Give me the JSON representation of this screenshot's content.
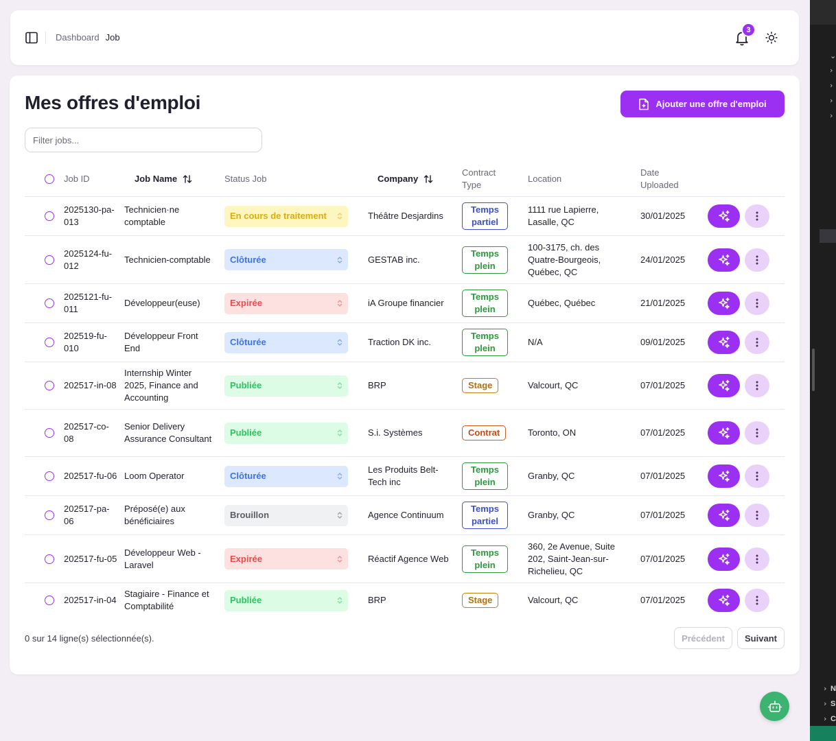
{
  "header": {
    "breadcrumb": [
      "Dashboard",
      "Job"
    ],
    "notification_count": "3"
  },
  "page": {
    "title": "Mes offres d'emploi",
    "add_button_label": "Ajouter une offre d'emploi",
    "filter_placeholder": "Filter jobs..."
  },
  "table": {
    "columns": {
      "job_id": "Job ID",
      "job_name": "Job Name",
      "status": "Status Job",
      "company": "Company",
      "contract": "Contract Type",
      "location": "Location",
      "date": "Date Uploaded"
    },
    "rows": [
      {
        "id": "2025130-pa-013",
        "name": "Technicien·ne comptable",
        "status": "En cours de traitement",
        "status_kind": "processing",
        "company": "Théâtre Desjardins",
        "contract": "Temps partiel",
        "contract_kind": "partial",
        "location": "1111 rue Lapierre, Lasalle, QC",
        "date": "30/01/2025"
      },
      {
        "id": "2025124-fu-012",
        "name": "Technicien-comptable",
        "status": "Clôturée",
        "status_kind": "closed",
        "company": "GESTAB inc.",
        "contract": "Temps plein",
        "contract_kind": "full",
        "location": "100-3175, ch. des Quatre-Bourgeois, Québec, QC",
        "date": "24/01/2025"
      },
      {
        "id": "2025121-fu-011",
        "name": "Développeur(euse)",
        "status": "Expirée",
        "status_kind": "expired",
        "company": "iA Groupe financier",
        "contract": "Temps plein",
        "contract_kind": "full",
        "location": "Québec, Québec",
        "date": "21/01/2025"
      },
      {
        "id": "202519-fu-010",
        "name": "Développeur Front End",
        "status": "Clôturée",
        "status_kind": "closed",
        "company": "Traction DK inc.",
        "contract": "Temps plein",
        "contract_kind": "full",
        "location": "N/A",
        "date": "09/01/2025"
      },
      {
        "id": "202517-in-08",
        "name": "Internship Winter 2025, Finance and Accounting",
        "status": "Publiée",
        "status_kind": "published",
        "company": "BRP",
        "contract": "Stage",
        "contract_kind": "stage",
        "location": "Valcourt, QC",
        "date": "07/01/2025"
      },
      {
        "id": "202517-co-08",
        "name": "Senior Delivery Assurance Consultant",
        "status": "Publiée",
        "status_kind": "published",
        "company": "S.i. Systèmes",
        "contract": "Contrat",
        "contract_kind": "contract",
        "location": "Toronto, ON",
        "date": "07/01/2025"
      },
      {
        "id": "202517-fu-06",
        "name": "Loom Operator",
        "status": "Clôturée",
        "status_kind": "closed",
        "company": "Les Produits Belt-Tech inc",
        "contract": "Temps plein",
        "contract_kind": "full",
        "location": "Granby, QC",
        "date": "07/01/2025"
      },
      {
        "id": "202517-pa-06",
        "name": "Préposé(e) aux bénéficiaires",
        "status": "Brouillon",
        "status_kind": "draft",
        "company": "Agence Continuum",
        "contract": "Temps partiel",
        "contract_kind": "partial",
        "location": "Granby, QC",
        "date": "07/01/2025"
      },
      {
        "id": "202517-fu-05",
        "name": "Développeur Web - Laravel",
        "status": "Expirée",
        "status_kind": "expired",
        "company": "Réactif Agence Web",
        "contract": "Temps plein",
        "contract_kind": "full",
        "location": "360, 2e Avenue, Suite 202, Saint-Jean-sur-Richelieu, QC",
        "date": "07/01/2025"
      },
      {
        "id": "202517-in-04",
        "name": "Stagiaire - Finance et Comptabilité",
        "status": "Publiée",
        "status_kind": "published",
        "company": "BRP",
        "contract": "Stage",
        "contract_kind": "stage",
        "location": "Valcourt, QC",
        "date": "07/01/2025"
      }
    ]
  },
  "footer": {
    "selection_text": "0 sur 14 ligne(s) sélectionnée(s).",
    "prev_label": "Précédent",
    "next_label": "Suivant"
  },
  "editor_panel": {
    "labels": [
      "N",
      "S",
      "C"
    ]
  },
  "colors": {
    "accent": "#9b2ff2",
    "bot": "#3cb371"
  }
}
